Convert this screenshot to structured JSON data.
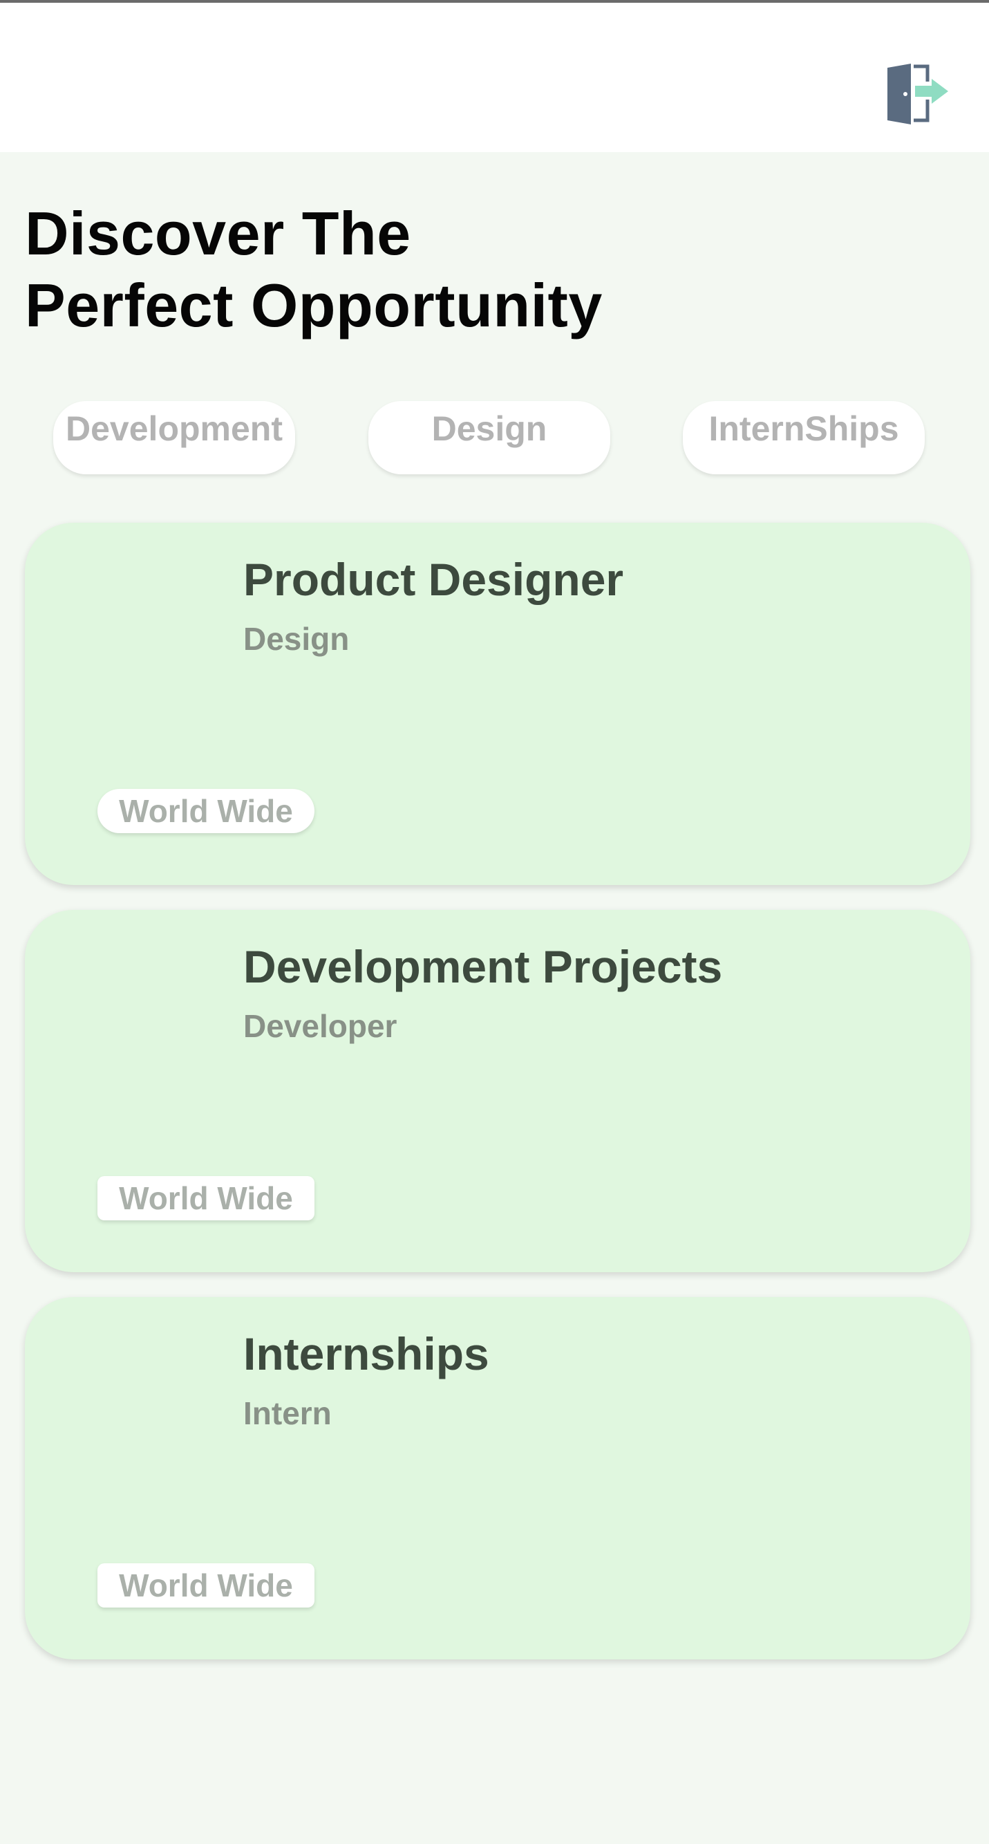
{
  "header": {
    "logout_icon": "logout-door-arrow-icon",
    "colors": {
      "door": "#5a6b80",
      "arrow": "#8fdcc2"
    }
  },
  "headline": {
    "line1": "Discover The",
    "line2": "Perfect Opportunity"
  },
  "categories": [
    {
      "label": "Development"
    },
    {
      "label": "Design"
    },
    {
      "label": "InternShips"
    }
  ],
  "jobs": [
    {
      "title": "Product Designer",
      "category": "Design",
      "location": "World Wide"
    },
    {
      "title": "Development Projects",
      "category": "Developer",
      "location": "World Wide"
    },
    {
      "title": "Internships",
      "category": "Intern",
      "location": "World Wide"
    }
  ],
  "colors": {
    "background": "#f3f8f2",
    "card": "#e0f7df",
    "title": "#3d4a3e",
    "subtitle": "#889187",
    "muted": "#b3b3b3"
  }
}
